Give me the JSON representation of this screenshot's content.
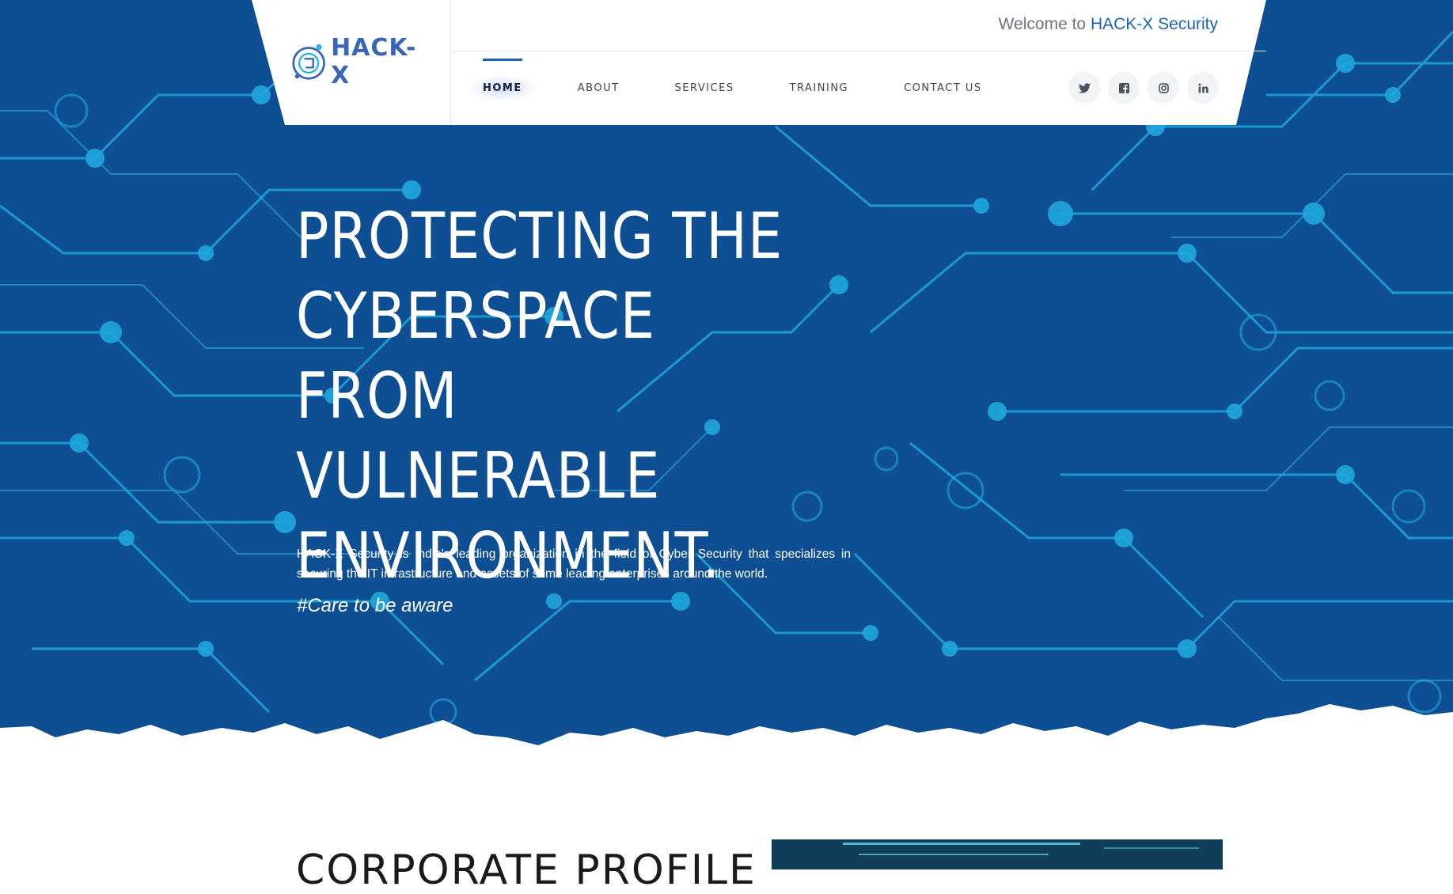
{
  "header": {
    "logo_text": "HACK-X",
    "welcome_prefix": "Welcome to",
    "welcome_brand": "HACK-X Security"
  },
  "nav": {
    "items": [
      {
        "label": "HOME",
        "active": true
      },
      {
        "label": "ABOUT",
        "active": false
      },
      {
        "label": "SERVICES",
        "active": false
      },
      {
        "label": "TRAINING",
        "active": false
      },
      {
        "label": "CONTACT US",
        "active": false
      }
    ]
  },
  "socials": [
    "twitter-icon",
    "facebook-icon",
    "instagram-icon",
    "linkedin-icon"
  ],
  "hero": {
    "title": "PROTECTING THE CYBERSPACE FROM VULNERABLE ENVIRONMENT.",
    "description": "HACK-X Security is India's leading organization in the field of Cyber Security that specializes in securing the IT infrastructure and assets of some leading enterprises around the world.",
    "tagline": "#Care to be aware"
  },
  "section": {
    "title": "CORPORATE PROFILE"
  },
  "colors": {
    "hero_bg": "#0e4f93",
    "circuit": "#1fa6dc",
    "brand": "#1c63b8",
    "logo": "#3b66b5"
  }
}
